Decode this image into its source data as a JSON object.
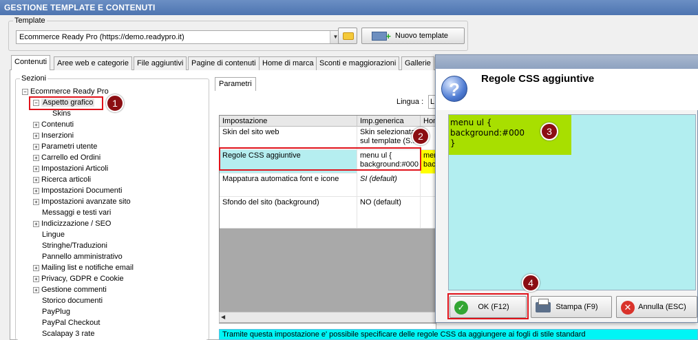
{
  "window": {
    "title": "GESTIONE TEMPLATE E CONTENUTI"
  },
  "template": {
    "group_label": "Template",
    "selected": "Ecommerce Ready Pro (https://demo.readypro.it)",
    "new_template_label": "Nuovo template"
  },
  "tabs": [
    {
      "label": "Contenuti"
    },
    {
      "label": "Aree web e categorie"
    },
    {
      "label": "File aggiuntivi"
    },
    {
      "label": "Pagine di contenuti"
    },
    {
      "label": "Home di marca"
    },
    {
      "label": "Sconti e maggiorazioni"
    },
    {
      "label": "Gallerie"
    }
  ],
  "sections": {
    "label": "Sezioni",
    "root": "Ecommerce Ready Pro",
    "items": [
      {
        "label": "Aspetto grafico",
        "expander": "⊟"
      },
      {
        "label": "Skins",
        "expander": ""
      },
      {
        "label": "Contenuti",
        "expander": "⊞"
      },
      {
        "label": "Inserzioni",
        "expander": "⊞"
      },
      {
        "label": "Parametri utente",
        "expander": "⊞"
      },
      {
        "label": "Carrello ed Ordini",
        "expander": "⊞"
      },
      {
        "label": "Impostazioni Articoli",
        "expander": "⊞"
      },
      {
        "label": "Ricerca articoli",
        "expander": "⊞"
      },
      {
        "label": "Impostazioni Documenti",
        "expander": "⊞"
      },
      {
        "label": "Impostazioni avanzate sito",
        "expander": "⊞"
      },
      {
        "label": "Messaggi e testi vari",
        "expander": ""
      },
      {
        "label": "Indicizzazione / SEO",
        "expander": "⊞"
      },
      {
        "label": "Lingue",
        "expander": ""
      },
      {
        "label": "Stringhe/Traduzioni",
        "expander": ""
      },
      {
        "label": "Pannello amministrativo",
        "expander": ""
      },
      {
        "label": "Mailing list e notifiche email",
        "expander": "⊞"
      },
      {
        "label": "Privacy, GDPR e Cookie",
        "expander": "⊞"
      },
      {
        "label": "Gestione commenti",
        "expander": "⊞"
      },
      {
        "label": "Storico documenti",
        "expander": ""
      },
      {
        "label": "PayPlug",
        "expander": ""
      },
      {
        "label": "PayPal Checkout",
        "expander": ""
      },
      {
        "label": "Scalapay 3 rate",
        "expander": ""
      }
    ]
  },
  "parameters": {
    "tab_label": "Parametri",
    "lingua_label": "Lingua :",
    "lingua_value": "L",
    "columns": [
      "Impostazione",
      "Imp.generica",
      "Hom"
    ],
    "rows": [
      {
        "setting": "Skin del sito web",
        "value": "Skin selezionata sul template (S...",
        "extra": ""
      },
      {
        "setting": "Regole CSS aggiuntive",
        "value": "menu ul { background:#000",
        "extra": "men bac"
      },
      {
        "setting": "Mappatura automatica font e icone",
        "value": "SI (default)",
        "extra": ""
      },
      {
        "setting": "Sfondo del sito (background)",
        "value": "NO (default)",
        "extra": ""
      }
    ]
  },
  "info_text": "Tramite questa impostazione e' possibile specificare delle regole CSS da aggiungere ai fogli di stile standard",
  "dialog": {
    "title": "Regole CSS aggiuntive",
    "code": "menu ul {\nbackground:#000\n}",
    "ok_label": "OK (F12)",
    "print_label": "Stampa (F9)",
    "cancel_label": "Annulla (ESC)"
  },
  "annotations": [
    "1",
    "2",
    "3",
    "4"
  ],
  "colors": {
    "accent_red": "#e0121a",
    "badge": "#8b0e13",
    "highlight_row": "#b5eef0",
    "code_highlight": "#a8df00",
    "info_bar": "#00f5f5"
  }
}
